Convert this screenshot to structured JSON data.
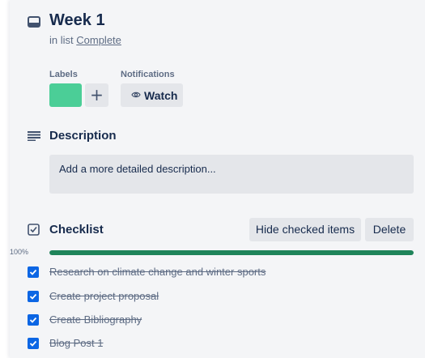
{
  "card": {
    "title": "Week 1",
    "in_list_prefix": "in list",
    "list_name": "Complete",
    "icon": "card-icon"
  },
  "labels": {
    "heading": "Labels",
    "swatch_color": "#4bce97",
    "add_label": "+"
  },
  "notifications": {
    "heading": "Notifications",
    "watch_label": "Watch",
    "icon": "eye-icon"
  },
  "description": {
    "heading": "Description",
    "placeholder": "Add a more detailed description...",
    "icon": "description-icon"
  },
  "checklist": {
    "heading": "Checklist",
    "icon": "checklist-icon",
    "hide_checked_label": "Hide checked items",
    "delete_label": "Delete",
    "progress_text": "100%",
    "progress": 1.0,
    "progress_color": "#1f845a",
    "items": [
      {
        "text": "Research on climate change and winter sports",
        "checked": true
      },
      {
        "text": "Create project proposal",
        "checked": true
      },
      {
        "text": "Create Bibliography",
        "checked": true
      },
      {
        "text": "Blog Post 1",
        "checked": true
      }
    ]
  },
  "colors": {
    "checkbox": "#0c66e4",
    "panel_bg": "#f4f5f7",
    "button_bg": "#e4e6ea"
  }
}
